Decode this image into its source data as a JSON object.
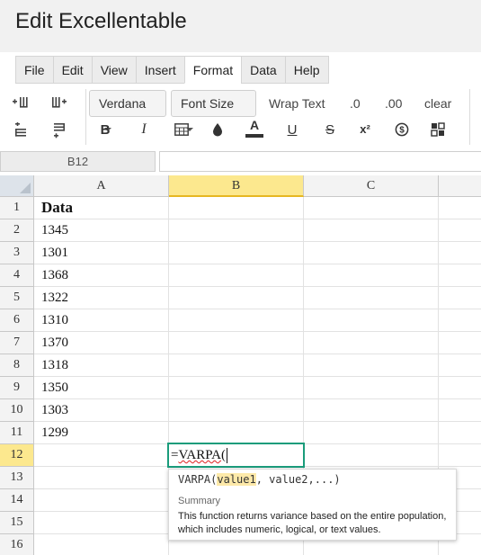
{
  "app": {
    "title": "Edit Excellentable"
  },
  "menu": [
    {
      "label": "File",
      "active": false
    },
    {
      "label": "Edit",
      "active": false
    },
    {
      "label": "View",
      "active": false
    },
    {
      "label": "Insert",
      "active": false
    },
    {
      "label": "Format",
      "active": true
    },
    {
      "label": "Data",
      "active": false
    },
    {
      "label": "Help",
      "active": false
    }
  ],
  "toolbar": {
    "font_family": "Verdana",
    "font_size": "Font Size",
    "wrap_text": "Wrap Text",
    "decrease_decimal": ".0",
    "increase_decimal": ".00",
    "clear": "clear",
    "bold": "B",
    "italic": "I",
    "font_color": "A",
    "underline": "U",
    "strikethrough": "S",
    "superscript": "x²",
    "currency": "$"
  },
  "formula_bar": {
    "cell_ref": "B12",
    "value": ""
  },
  "columns": [
    "A",
    "B",
    "C"
  ],
  "selected_column": "B",
  "rows": [
    "1",
    "2",
    "3",
    "4",
    "5",
    "6",
    "7",
    "8",
    "9",
    "10",
    "11",
    "12",
    "13",
    "14",
    "15",
    "16"
  ],
  "selected_row": "12",
  "cells_a": [
    "Data",
    "1345",
    "1301",
    "1368",
    "1322",
    "1310",
    "1370",
    "1318",
    "1350",
    "1303",
    "1299",
    "",
    "",
    "",
    "",
    ""
  ],
  "editor": {
    "prefix": "=",
    "function_name": "VARPA",
    "suffix": "("
  },
  "tooltip": {
    "func": "VARPA(",
    "arg1": "value1",
    "rest": ", value2,...)",
    "summary_label": "Summary",
    "description": "This function returns variance based on the entire population, which includes numeric, logical, or text values."
  },
  "colors": {
    "accent": "#1a9c7b",
    "selection": "#fce88e"
  }
}
